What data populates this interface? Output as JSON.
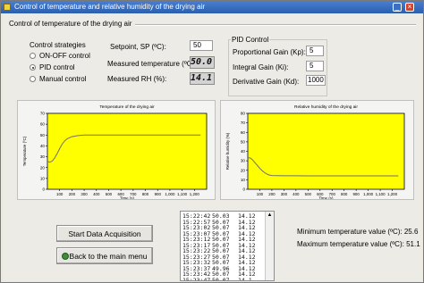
{
  "window": {
    "title": "Control of temperature and relative humidity of the drying air"
  },
  "section": {
    "title": "Control of temperature of the drying air"
  },
  "strategies": {
    "label": "Control strategies",
    "options": [
      {
        "label": "ON-OFF control",
        "selected": false
      },
      {
        "label": "PID control",
        "selected": true
      },
      {
        "label": "Manual control",
        "selected": false
      }
    ]
  },
  "setpoint": {
    "label": "Setpoint, SP (ºC):",
    "value": "50"
  },
  "measured_temp": {
    "label": "Measured temperature (ºC):",
    "value": "50.0"
  },
  "measured_rh": {
    "label": "Measured RH (%):",
    "value": "14.1"
  },
  "pid": {
    "label": "PID Control",
    "kp_label": "Proportional Gain (Kp):",
    "kp": "5",
    "ki_label": "Integral Gain (Ki):",
    "ki": "5",
    "kd_label": "Derivative Gain (Kd):",
    "kd": "1000"
  },
  "buttons": {
    "start": "Start Data Acquisition",
    "back": "Back to the main menu"
  },
  "log_rows": [
    {
      "time": "15:22:42",
      "temp": "50.03",
      "rh": "14.12"
    },
    {
      "time": "15:22:57",
      "temp": "50.07",
      "rh": "14.12"
    },
    {
      "time": "15:23:02",
      "temp": "50.07",
      "rh": "14.12"
    },
    {
      "time": "15:23:07",
      "temp": "50.07",
      "rh": "14.12"
    },
    {
      "time": "15:23:12",
      "temp": "50.07",
      "rh": "14.12"
    },
    {
      "time": "15:23:17",
      "temp": "50.07",
      "rh": "14.12"
    },
    {
      "time": "15:23:22",
      "temp": "50.07",
      "rh": "14.12"
    },
    {
      "time": "15:23:27",
      "temp": "50.07",
      "rh": "14.12"
    },
    {
      "time": "15:23:32",
      "temp": "50.07",
      "rh": "14.12"
    },
    {
      "time": "15:23:37",
      "temp": "49.96",
      "rh": "14.12"
    },
    {
      "time": "15:23:42",
      "temp": "50.07",
      "rh": "14.12"
    },
    {
      "time": "15:23:47",
      "temp": "50.07",
      "rh": "14.1"
    }
  ],
  "stats": {
    "min_label": "Minimum temperature value (ºC):",
    "min_value": "25.6",
    "max_label": "Maximum temperature value (ºC):",
    "max_value": "51.1"
  },
  "colors": {
    "plot_bg": "#ffff00",
    "line": "#707070",
    "axes": "#000000"
  },
  "chart_data": [
    {
      "type": "line",
      "title": "Temperature of the drying air",
      "xlabel": "Time (s)",
      "ylabel": "Temperature (ºC)",
      "xlim": [
        0,
        1300
      ],
      "ylim": [
        0,
        70
      ],
      "xticks": [
        "100",
        "200",
        "300",
        "400",
        "500",
        "600",
        "700",
        "800",
        "900",
        "1,000",
        "1,100",
        "1,200"
      ],
      "yticks": [
        "0",
        "10",
        "20",
        "30",
        "40",
        "50",
        "60",
        "70"
      ],
      "grid": false,
      "series": [
        {
          "x": [
            0,
            20,
            40,
            60,
            80,
            100,
            120,
            140,
            160,
            180,
            200,
            250,
            300,
            400,
            500,
            600,
            700,
            800,
            900,
            1000,
            1100,
            1200,
            1250
          ],
          "y": [
            25.6,
            25,
            26,
            29,
            33,
            37.5,
            41.5,
            44.5,
            46.5,
            47.5,
            48.5,
            49.5,
            50,
            50,
            50.1,
            50,
            50,
            50.1,
            50,
            50,
            50.1,
            50,
            50
          ]
        }
      ]
    },
    {
      "type": "line",
      "title": "Relative humidity of the drying air",
      "xlabel": "Time (s)",
      "ylabel": "Relative humidity (%)",
      "xlim": [
        0,
        1300
      ],
      "ylim": [
        0,
        80
      ],
      "xticks": [
        "100",
        "200",
        "300",
        "400",
        "500",
        "600",
        "700",
        "800",
        "900",
        "1,000",
        "1,100",
        "1,200"
      ],
      "yticks": [
        "0",
        "10",
        "20",
        "30",
        "40",
        "50",
        "60",
        "70",
        "80"
      ],
      "grid": false,
      "series": [
        {
          "x": [
            0,
            20,
            40,
            60,
            80,
            100,
            120,
            140,
            160,
            180,
            200,
            250,
            300,
            400,
            500,
            600,
            700,
            800,
            900,
            1000,
            1100,
            1200,
            1250
          ],
          "y": [
            33,
            33,
            31,
            28,
            25,
            22,
            19.5,
            17.5,
            16,
            15,
            14.5,
            14.3,
            14.2,
            14.2,
            14.1,
            14.1,
            14.1,
            14.1,
            14.1,
            14.1,
            14.1,
            14.1,
            14.1
          ]
        }
      ]
    }
  ]
}
